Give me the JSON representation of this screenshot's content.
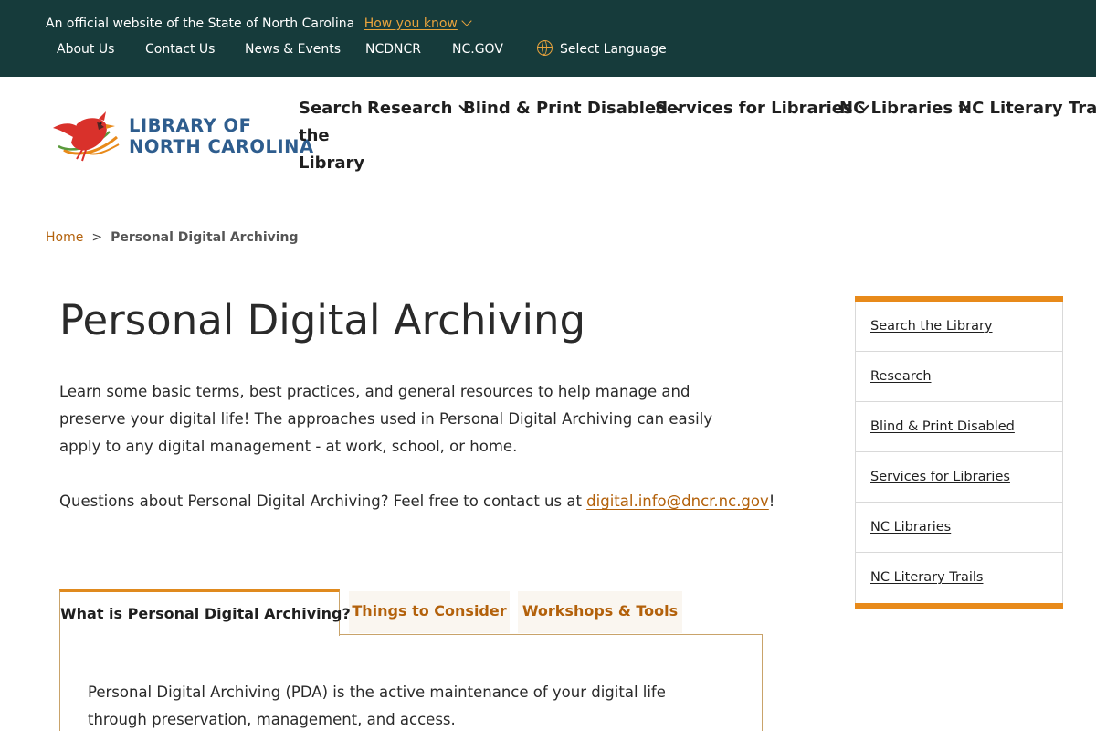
{
  "gov_banner": {
    "official_text": "An official website of the State of North Carolina",
    "how_you_know": "How you know",
    "utility_links": [
      "About Us",
      "Contact Us",
      "News & Events",
      "NCDNCR",
      "NC.GOV"
    ],
    "select_language": "Select Language"
  },
  "header": {
    "logo_line1": "LIBRARY OF",
    "logo_line2": "NORTH CAROLINA",
    "nav": {
      "search_line1": "Search",
      "search_line2": "the",
      "search_line3": "Library",
      "items": [
        "Research",
        "Blind & Print Disabled",
        "Services for Libraries",
        "NC Libraries",
        "NC Literary Trails"
      ]
    }
  },
  "breadcrumb": {
    "home": "Home",
    "separator": ">",
    "current": "Personal Digital Archiving"
  },
  "main": {
    "title": "Personal Digital Archiving",
    "intro": "Learn some basic terms, best practices, and general resources to help manage and preserve your digital life! The approaches used in Personal Digital Archiving can easily apply to any digital management - at work, school, or home.",
    "contact_prefix": "Questions about Personal Digital Archiving? Feel free to contact us at ",
    "contact_email": "digital.info@dncr.nc.gov",
    "contact_suffix": "!",
    "tabs": [
      "What is Personal Digital Archiving?",
      "Things to Consider",
      "Workshops & Tools"
    ],
    "panel_text": "Personal Digital Archiving (PDA) is the active maintenance of your digital life through preservation, management, and access."
  },
  "sidebar": {
    "items": [
      "Search the Library",
      "Research",
      "Blind & Print Disabled",
      "Services for Libraries",
      "NC Libraries",
      "NC Literary Trails"
    ]
  },
  "colors": {
    "banner_bg": "#163b3b",
    "accent_orange": "#e88a1a",
    "link_brown": "#b3610b",
    "logo_blue": "#2e5d8e",
    "cardinal_red": "#d9312b"
  }
}
